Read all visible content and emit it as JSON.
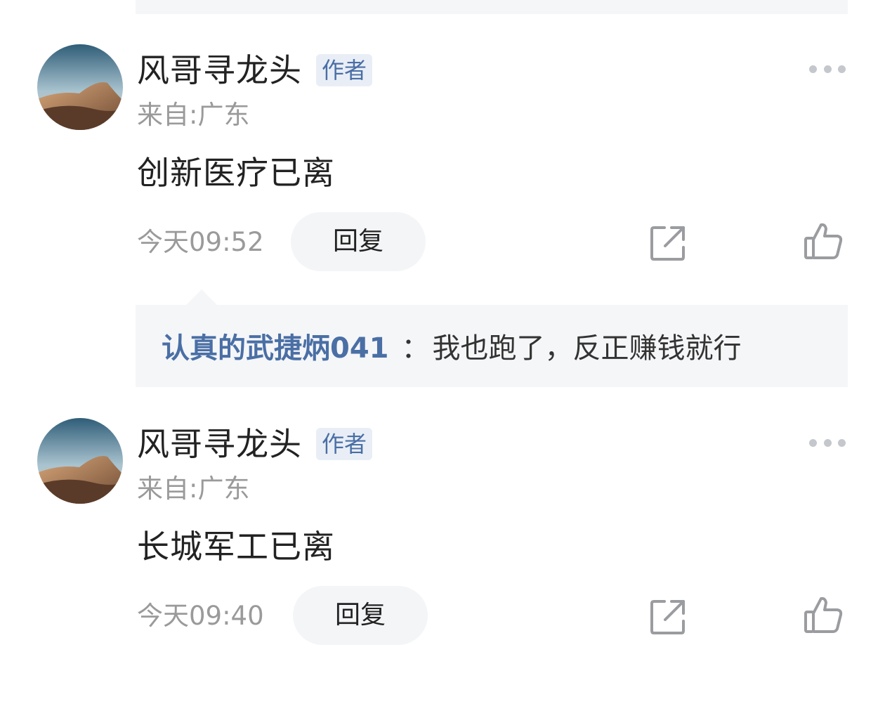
{
  "comments": [
    {
      "author": "风哥寻龙头",
      "badge": "作者",
      "location": "来自:广东",
      "content": "创新医疗已离",
      "time": "今天09:52",
      "reply_label": "回复",
      "sub_replies": [
        {
          "user": "认真的武捷炳041",
          "separator": "：",
          "text": "我也跑了，反正赚钱就行"
        }
      ]
    },
    {
      "author": "风哥寻龙头",
      "badge": "作者",
      "location": "来自:广东",
      "content": "长城军工已离",
      "time": "今天09:40",
      "reply_label": "回复"
    }
  ],
  "icons": {
    "more": "more-icon",
    "share": "share-icon",
    "like": "thumbs-up-icon",
    "avatar": "desert-avatar"
  },
  "colors": {
    "badge_text": "#4a6fa5",
    "badge_bg": "#e9eef6",
    "link": "#4a6fa5",
    "muted": "#9a9a9a",
    "panel_bg": "#f5f6f8"
  }
}
